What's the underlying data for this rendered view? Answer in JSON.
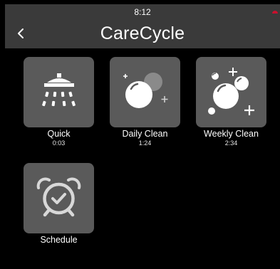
{
  "status_bar": {
    "time": "8:12"
  },
  "header": {
    "title": "CareCycle",
    "back_icon": "chevron-left-icon"
  },
  "programs": [
    {
      "label": "Quick",
      "duration": "0:03",
      "icon": "shower-icon"
    },
    {
      "label": "Daily Clean",
      "duration": "1:24",
      "icon": "bubbles-icon"
    },
    {
      "label": "Weekly Clean",
      "duration": "2:34",
      "icon": "bubbles-sparkle-icon"
    },
    {
      "label": "Schedule",
      "icon": "alarm-clock-icon"
    }
  ],
  "colors": {
    "header_bg": "#3a3a3a",
    "tile_bg": "#5a5a5a",
    "accent_dot": "#c8102e"
  }
}
